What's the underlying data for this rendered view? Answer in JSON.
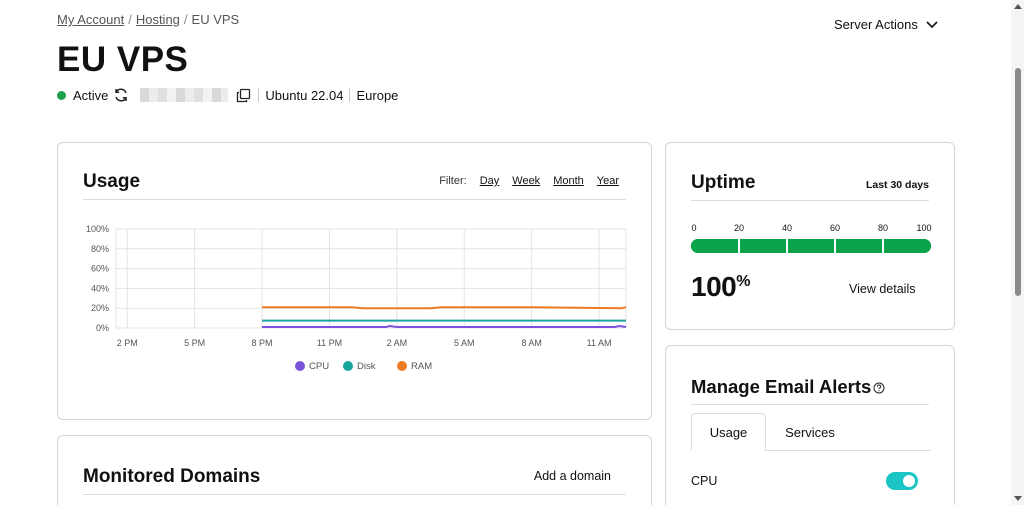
{
  "breadcrumb": {
    "items": [
      "My Account",
      "Hosting"
    ],
    "current": "EU VPS",
    "separator": "/"
  },
  "header": {
    "title": "EU VPS",
    "server_actions_label": "Server Actions",
    "status": "Active",
    "os": "Ubuntu 22.04",
    "region": "Europe",
    "status_color": "#1fa04a"
  },
  "usage": {
    "title": "Usage",
    "filter_label": "Filter:",
    "filters": [
      "Day",
      "Week",
      "Month",
      "Year"
    ],
    "legend": [
      {
        "name": "CPU",
        "color": "#7b55d9"
      },
      {
        "name": "Disk",
        "color": "#18a5a0"
      },
      {
        "name": "RAM",
        "color": "#ef7a22"
      }
    ]
  },
  "chart_data": {
    "type": "line",
    "title": "Usage",
    "xlabel": "",
    "ylabel": "",
    "ylim": [
      0,
      100
    ],
    "y_ticks": [
      "0%",
      "20%",
      "40%",
      "60%",
      "80%",
      "100%"
    ],
    "x_ticks": [
      "2 PM",
      "5 PM",
      "8 PM",
      "11 PM",
      "2 AM",
      "5 AM",
      "8 AM",
      "11 AM"
    ],
    "x_range_hours": [
      13.5,
      36.2
    ],
    "grid": true,
    "legend_position": "bottom",
    "series": [
      {
        "name": "RAM",
        "color": "#ef7a22",
        "x": [
          20,
          24,
          24.5,
          27.5,
          28,
          32,
          36,
          36.2
        ],
        "y": [
          21,
          21,
          20,
          20,
          21,
          21,
          20,
          21
        ]
      },
      {
        "name": "Disk",
        "color": "#18a5a0",
        "x": [
          20,
          36.2
        ],
        "y": [
          7.5,
          7.5
        ]
      },
      {
        "name": "CPU",
        "color": "#7b55d9",
        "x": [
          20,
          25.5,
          25.7,
          26,
          33,
          35.7,
          35.9,
          36.2
        ],
        "y": [
          1,
          1,
          2,
          1,
          1,
          1,
          2,
          1
        ]
      }
    ]
  },
  "uptime": {
    "title": "Uptime",
    "period": "Last 30 days",
    "scale": [
      "0",
      "20",
      "40",
      "60",
      "80",
      "100"
    ],
    "value": "100",
    "unit": "%",
    "fraction": 1.0,
    "bar_color": "#09a34a",
    "view_details": "View details"
  },
  "alerts": {
    "title": "Manage Email Alerts",
    "tabs": [
      "Usage",
      "Services"
    ],
    "active_tab": "Usage",
    "rows": [
      {
        "label": "CPU",
        "enabled": true
      }
    ],
    "toggle_color": "#1bc5c5"
  },
  "domains": {
    "title": "Monitored Domains",
    "add_label": "Add a domain"
  }
}
